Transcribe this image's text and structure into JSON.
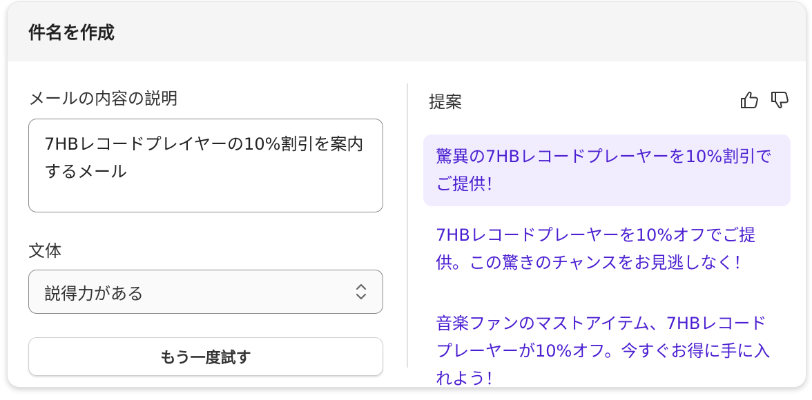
{
  "header": {
    "title": "件名を作成"
  },
  "form": {
    "description_label": "メールの内容の説明",
    "description_value": "7HBレコードプレイヤーの10%割引を案内するメール",
    "style_label": "文体",
    "style_value": "説得力がある",
    "retry_label": "もう一度試す"
  },
  "suggestions": {
    "title": "提案",
    "items": [
      "驚異の7HBレコードプレーヤーを10%割引でご提供！",
      "7HBレコードプレーヤーを10%オフでご提供。この驚きのチャンスをお見逃しなく！",
      "音楽ファンのマストアイテム、7HBレコードプレーヤーが10%オフ。今すぐお得に手に入れよう！"
    ]
  },
  "icons": {
    "thumbs_up": "thumbs-up-icon",
    "thumbs_down": "thumbs-down-icon",
    "select_chevron": "chevron-up-down-icon"
  },
  "colors": {
    "accent_text": "#4b1fd1",
    "selected_bg": "#f1edff",
    "header_bg": "#f5f5f5"
  }
}
